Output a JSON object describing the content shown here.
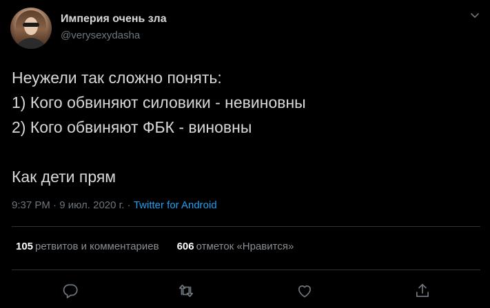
{
  "author": {
    "display_name": "Империя очень зла",
    "handle": "@verysexydasha"
  },
  "tweet": {
    "text": "Неужели так сложно понять:\n1) Кого обвиняют силовики - невиновны\n2) Кого обвиняют ФБК - виновны\n\nКак дети прям",
    "time": "9:37 PM",
    "date": "9 июл. 2020 г.",
    "separator": " · ",
    "source": "Twitter for Android"
  },
  "stats": {
    "retweets_count": "105",
    "retweets_label": "ретвитов и комментариев",
    "likes_count": "606",
    "likes_label": "отметок «Нравится»"
  },
  "icons": {
    "more": "chevron-down-icon",
    "reply": "reply-icon",
    "retweet": "retweet-icon",
    "like": "heart-icon",
    "share": "share-icon"
  },
  "colors": {
    "background": "#000000",
    "text": "#d9d9d9",
    "secondary": "#6e767d",
    "link": "#1da1f2",
    "divider": "#2f3336"
  }
}
